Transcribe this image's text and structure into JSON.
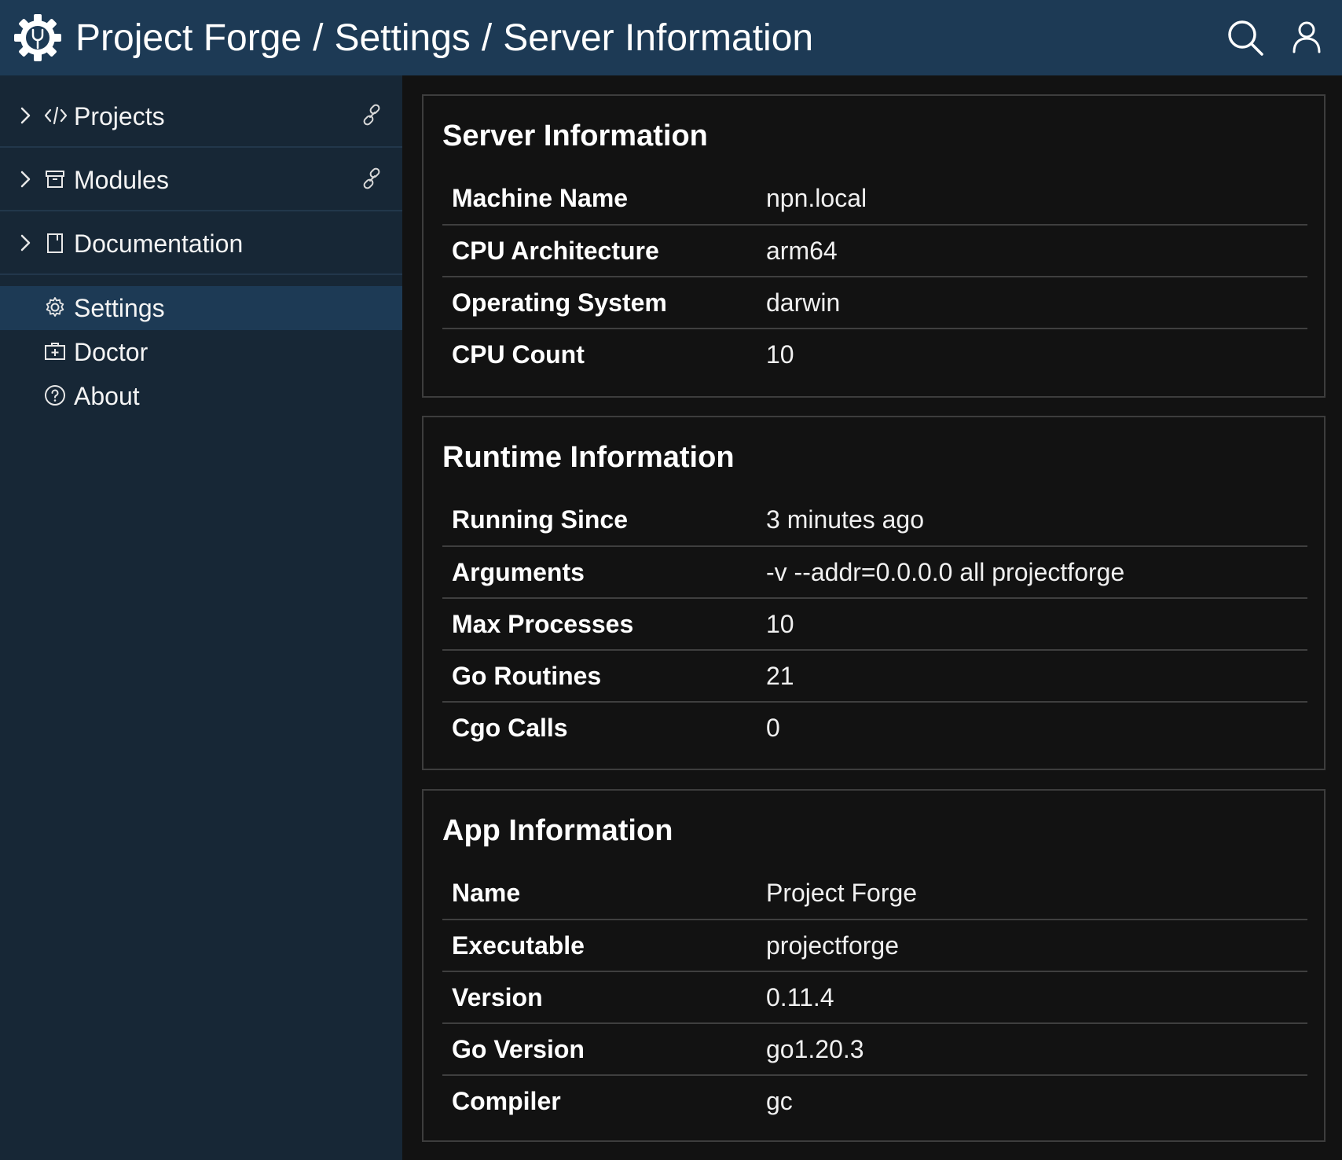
{
  "header": {
    "breadcrumb": [
      "Project Forge",
      "Settings",
      "Server Information"
    ],
    "separator": "/",
    "background": "#1d3a55"
  },
  "sidebar": {
    "background": "#172736",
    "folders": [
      {
        "label": "Projects",
        "icon": "code-icon",
        "has_link": true
      },
      {
        "label": "Modules",
        "icon": "archive-icon",
        "has_link": true
      },
      {
        "label": "Documentation",
        "icon": "book-icon",
        "has_link": false
      }
    ],
    "items": [
      {
        "label": "Settings",
        "icon": "gear-icon",
        "active": true
      },
      {
        "label": "Doctor",
        "icon": "first-aid-kit-icon",
        "active": false
      },
      {
        "label": "About",
        "icon": "help-circle-icon",
        "active": false
      }
    ]
  },
  "sections": {
    "server": {
      "title": "Server Information",
      "rows": [
        {
          "key": "Machine Name",
          "value": "npn.local"
        },
        {
          "key": "CPU Architecture",
          "value": "arm64"
        },
        {
          "key": "Operating System",
          "value": "darwin"
        },
        {
          "key": "CPU Count",
          "value": "10"
        }
      ]
    },
    "runtime": {
      "title": "Runtime Information",
      "rows": [
        {
          "key": "Running Since",
          "value": "3 minutes ago"
        },
        {
          "key": "Arguments",
          "value": "-v --addr=0.0.0.0 all projectforge"
        },
        {
          "key": "Max Processes",
          "value": "10"
        },
        {
          "key": "Go Routines",
          "value": "21"
        },
        {
          "key": "Cgo Calls",
          "value": "0"
        }
      ]
    },
    "app": {
      "title": "App Information",
      "rows": [
        {
          "key": "Name",
          "value": "Project Forge"
        },
        {
          "key": "Executable",
          "value": "projectforge"
        },
        {
          "key": "Version",
          "value": "0.11.4"
        },
        {
          "key": "Go Version",
          "value": "go1.20.3"
        },
        {
          "key": "Compiler",
          "value": "gc"
        }
      ]
    }
  }
}
